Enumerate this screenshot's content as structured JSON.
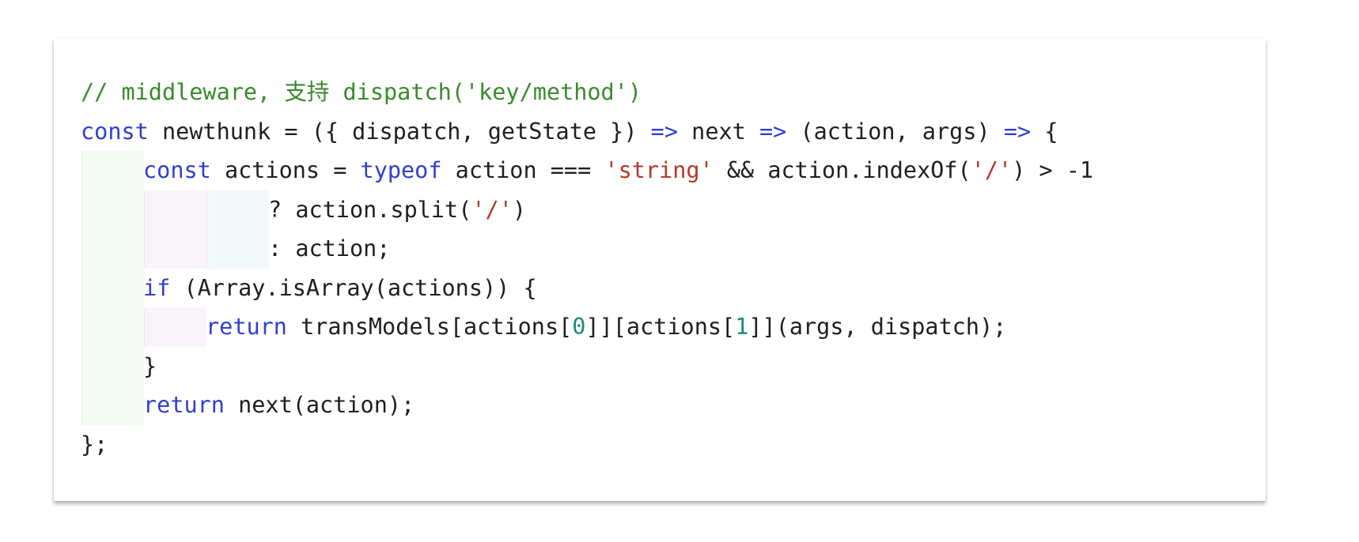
{
  "code_lines": [
    {
      "indent": 0,
      "tokens": [
        {
          "type": "comment",
          "text": "// middleware, 支持 dispatch('key/method')"
        }
      ]
    },
    {
      "indent": 0,
      "tokens": [
        {
          "type": "kw",
          "text": "const"
        },
        {
          "type": "plain",
          "text": " newthunk = ({ dispatch, getState }) "
        },
        {
          "type": "op",
          "text": "=>"
        },
        {
          "type": "plain",
          "text": " next "
        },
        {
          "type": "op",
          "text": "=>"
        },
        {
          "type": "plain",
          "text": " (action, args) "
        },
        {
          "type": "op",
          "text": "=>"
        },
        {
          "type": "plain",
          "text": " {"
        }
      ]
    },
    {
      "indent": 1,
      "tokens": [
        {
          "type": "kw",
          "text": "const"
        },
        {
          "type": "plain",
          "text": " actions = "
        },
        {
          "type": "kw",
          "text": "typeof"
        },
        {
          "type": "plain",
          "text": " action === "
        },
        {
          "type": "str",
          "text": "'string'"
        },
        {
          "type": "plain",
          "text": " && action.indexOf("
        },
        {
          "type": "str",
          "text": "'/'"
        },
        {
          "type": "plain",
          "text": ") > -1"
        }
      ]
    },
    {
      "indent": 3,
      "tokens": [
        {
          "type": "plain",
          "text": "? action.split("
        },
        {
          "type": "str",
          "text": "'/'"
        },
        {
          "type": "plain",
          "text": ")"
        }
      ]
    },
    {
      "indent": 3,
      "tokens": [
        {
          "type": "plain",
          "text": ": action;"
        }
      ]
    },
    {
      "indent": 1,
      "tokens": [
        {
          "type": "kw",
          "text": "if"
        },
        {
          "type": "plain",
          "text": " (Array.isArray(actions)) {"
        }
      ]
    },
    {
      "indent": 2,
      "tokens": [
        {
          "type": "kw",
          "text": "return"
        },
        {
          "type": "plain",
          "text": " transModels[actions["
        },
        {
          "type": "num",
          "text": "0"
        },
        {
          "type": "plain",
          "text": "]][actions["
        },
        {
          "type": "num",
          "text": "1"
        },
        {
          "type": "plain",
          "text": "]](args, dispatch);"
        }
      ]
    },
    {
      "indent": 1,
      "tokens": [
        {
          "type": "plain",
          "text": "}"
        }
      ]
    },
    {
      "indent": 1,
      "tokens": [
        {
          "type": "kw",
          "text": "return"
        },
        {
          "type": "plain",
          "text": " next(action);"
        }
      ]
    },
    {
      "indent": 0,
      "tokens": [
        {
          "type": "plain",
          "text": "};"
        }
      ]
    }
  ],
  "colors": {
    "comment": "#3a8a2c",
    "keyword": "#2f3fd0",
    "string": "#b23a2a",
    "number": "#1c8a78",
    "text": "#1f1f1f"
  }
}
